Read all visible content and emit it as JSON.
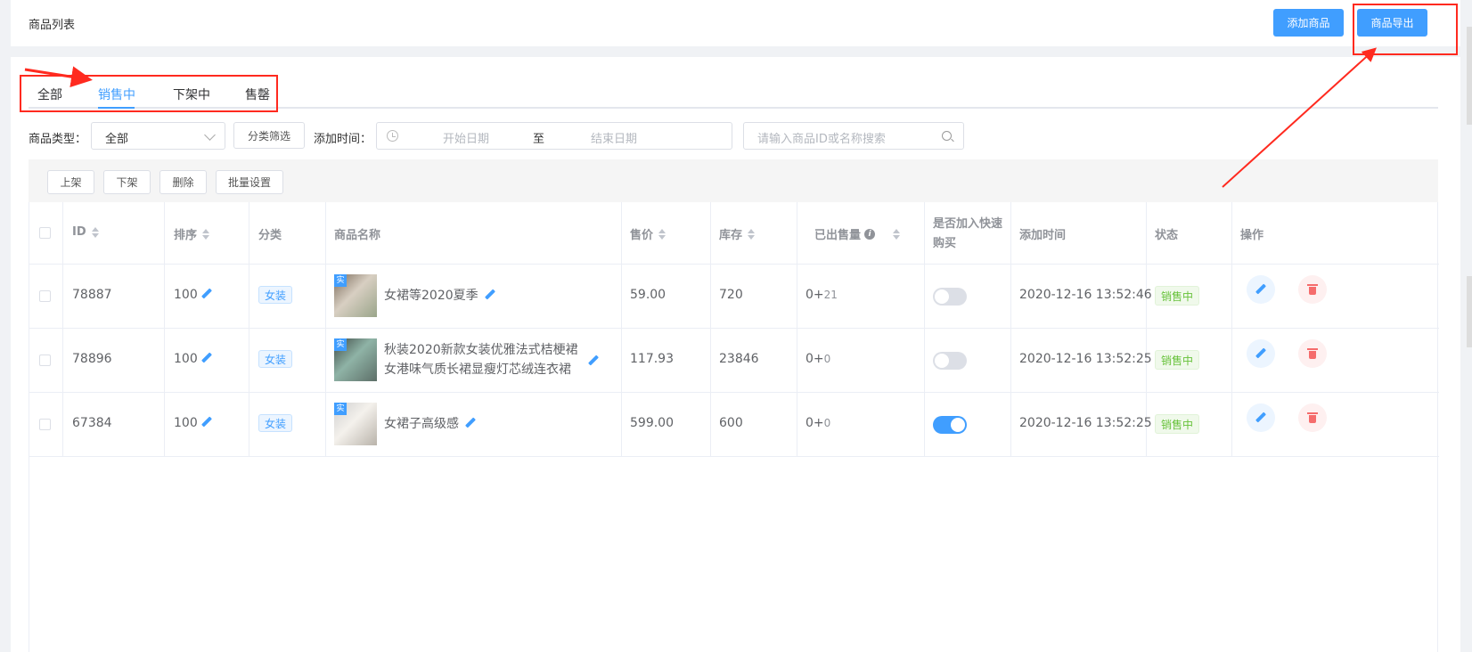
{
  "header": {
    "title": "商品列表",
    "add_button": "添加商品",
    "export_button": "商品导出"
  },
  "tabs": [
    {
      "label": "全部"
    },
    {
      "label": "销售中",
      "active": true
    },
    {
      "label": "下架中"
    },
    {
      "label": "售罄"
    }
  ],
  "filters": {
    "type_label": "商品类型：",
    "type_value": "全部",
    "category_button": "分类筛选",
    "time_label": "添加时间：",
    "start_placeholder": "开始日期",
    "range_separator": "至",
    "end_placeholder": "结束日期",
    "search_placeholder": "请输入商品ID或名称搜索"
  },
  "toolbar": {
    "shelve": "上架",
    "unshelve": "下架",
    "delete": "删除",
    "batch": "批量设置"
  },
  "columns": {
    "id": "ID",
    "sort": "排序",
    "category": "分类",
    "name": "商品名称",
    "price": "售价",
    "stock": "库存",
    "sold": "已出售量",
    "quick_buy": "是否加入快速购买",
    "added": "添加时间",
    "status": "状态",
    "ops": "操作"
  },
  "rows": [
    {
      "id": "78887",
      "sort": "100",
      "category": "女装",
      "badge": "实",
      "name": "女裙等2020夏季",
      "price": "59.00",
      "stock": "720",
      "sold_base": "0+",
      "sold_extra": "21",
      "quick_buy": false,
      "added": "2020-12-16 13:52:46",
      "status": "销售中"
    },
    {
      "id": "78896",
      "sort": "100",
      "category": "女装",
      "badge": "实",
      "name": "秋装2020新款女装优雅法式桔梗裙女港味气质长裙显瘦灯芯绒连衣裙",
      "price": "117.93",
      "stock": "23846",
      "sold_base": "0+",
      "sold_extra": "0",
      "quick_buy": false,
      "added": "2020-12-16 13:52:25",
      "status": "销售中"
    },
    {
      "id": "67384",
      "sort": "100",
      "category": "女装",
      "badge": "实",
      "name": "女裙子高级感",
      "price": "599.00",
      "stock": "600",
      "sold_base": "0+",
      "sold_extra": "0",
      "quick_buy": true,
      "added": "2020-12-16 13:52:25",
      "status": "销售中"
    }
  ],
  "colors": {
    "primary": "#409eff",
    "success": "#67c23a",
    "danger": "#f56c6c",
    "annotation": "#ff2a1f"
  }
}
